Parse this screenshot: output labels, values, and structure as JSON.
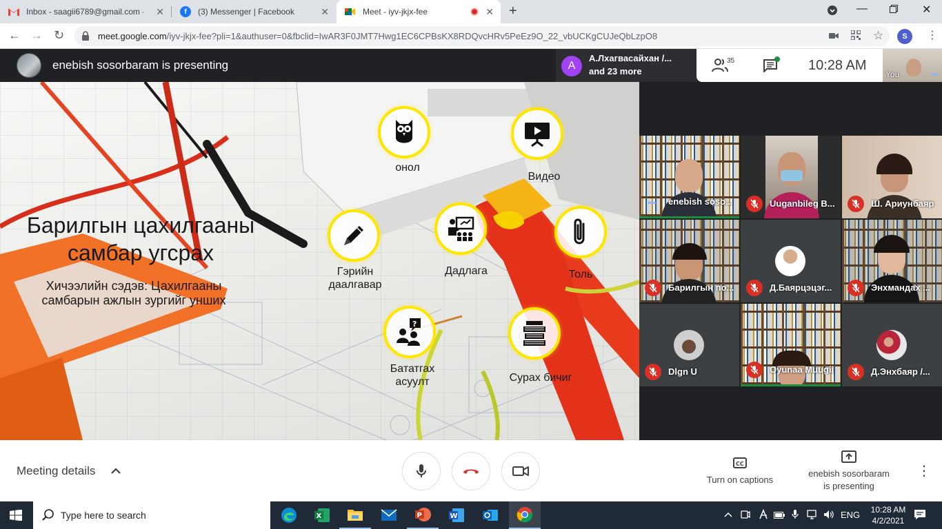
{
  "browser": {
    "tabs": [
      {
        "title": "Inbox - saagii6789@gmail.com -",
        "icon": "gmail-icon"
      },
      {
        "title": "(3) Messenger | Facebook",
        "icon": "facebook-icon"
      },
      {
        "title": "Meet - iyv-jkjx-fee",
        "icon": "meet-icon",
        "active": true
      }
    ],
    "url_host": "meet.google.com",
    "url_path": "/iyv-jkjx-fee?pli=1&authuser=0&fbclid=IwAR3F0JMT7Hwg1EC6CPBsKX8RDQvcHRv5PeEz9O_22_vbUCKgCUJeQbLzpO8",
    "profile_initial": "S"
  },
  "meet": {
    "presenting_banner": "enebish sosorbaram is presenting",
    "speaker_initial": "A",
    "speaker_name": "А.Лхагвасайхан /...",
    "speaker_more": "and 23 more",
    "participant_count": "35",
    "clock": "10:28  AM",
    "self_label": "You"
  },
  "slide": {
    "title": "Барилгын цахилгааны самбар угсрах",
    "subtitle": "Хичээлийн сэдэв: Цахилгааны самбарын ажлын зургийг унших",
    "nodes": [
      {
        "label": "онол",
        "icon": "owl-icon"
      },
      {
        "label": "Видео",
        "icon": "video-board-icon"
      },
      {
        "label": "Гэрийн даалгавар",
        "icon": "pencil-icon"
      },
      {
        "label": "Дадлага",
        "icon": "training-icon"
      },
      {
        "label": "Толь",
        "icon": "paperclip-icon"
      },
      {
        "label": "Бататгах асуулт",
        "icon": "question-group-icon"
      },
      {
        "label": "Сурах бичиг",
        "icon": "books-icon"
      }
    ]
  },
  "tiles": [
    {
      "name": "enebish soso...",
      "muted": false
    },
    {
      "name": "Uuganbileg B...",
      "muted": true
    },
    {
      "name": "Ш. Ариунбаяр",
      "muted": true
    },
    {
      "name": "Барилгын по...",
      "muted": true
    },
    {
      "name": "Д.Баярцэцэг...",
      "muted": true
    },
    {
      "name": "Энхмандах ...",
      "muted": true
    },
    {
      "name": "Dlgn U",
      "muted": true
    },
    {
      "name": "Oyunaa Muugii",
      "muted": true
    },
    {
      "name": "Д.Энхбаяр /...",
      "muted": true
    }
  ],
  "controls": {
    "meeting_details": "Meeting details",
    "captions_label": "Turn on captions",
    "presenting_line1": "enebish sosorbaram",
    "presenting_line2": "is presenting"
  },
  "taskbar": {
    "search_placeholder": "Type here to search",
    "language": "ENG",
    "time": "10:28 AM",
    "date": "4/2/2021"
  },
  "colors": {
    "node_border": "#ffe600",
    "mute_red": "#d93025",
    "speaker_purple": "#a142f4",
    "active_green": "#1e8e3e"
  }
}
